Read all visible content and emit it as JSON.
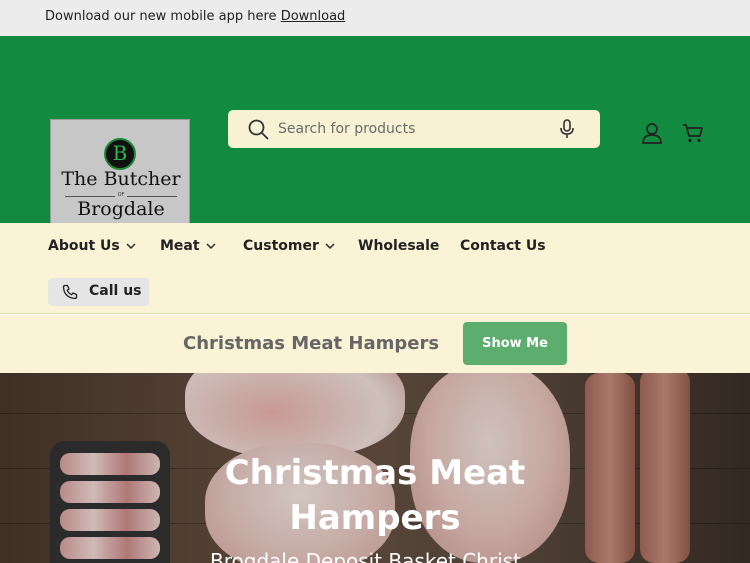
{
  "announcement": {
    "text": "Download our new mobile app here ",
    "link": "Download"
  },
  "logo": {
    "badge": "B",
    "line1": "The Butcher",
    "of": "OF",
    "line2": "Brogdale"
  },
  "search": {
    "placeholder": "Search for products"
  },
  "nav": {
    "items": [
      {
        "label": "About Us",
        "has_dropdown": true
      },
      {
        "label": "Meat",
        "has_dropdown": true
      },
      {
        "label": "Customer",
        "has_dropdown": true
      },
      {
        "label": "Wholesale",
        "has_dropdown": false
      },
      {
        "label": "Contact Us",
        "has_dropdown": false
      }
    ],
    "call_label": "Call us"
  },
  "promo": {
    "text": "Christmas Meat Hampers",
    "button": "Show Me"
  },
  "hero": {
    "title": "Christmas Meat Hampers",
    "subtitle": "Brogdale Deposit Basket Christ..."
  },
  "colors": {
    "header_green": "#128a3f",
    "cream": "#faf3d6",
    "button_green": "#5cad6e",
    "search_bg": "#f7f2d4"
  },
  "icons": [
    "search-icon",
    "mic-icon",
    "account-icon",
    "cart-icon",
    "chevron-down-icon",
    "phone-icon"
  ]
}
